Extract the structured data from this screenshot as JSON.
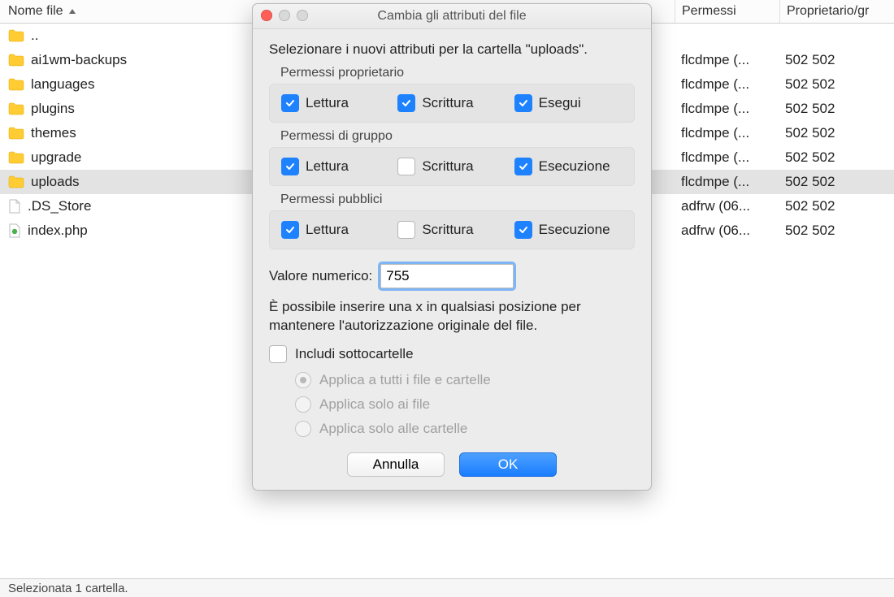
{
  "columns": {
    "name": "Nome file",
    "perm": "Permessi",
    "owner": "Proprietario/gr"
  },
  "files": [
    {
      "name": "..",
      "kind": "folder",
      "perm": "",
      "owner": "",
      "selected": false
    },
    {
      "name": "ai1wm-backups",
      "kind": "folder",
      "perm": "flcdmpe (...",
      "owner": "502 502",
      "selected": false
    },
    {
      "name": "languages",
      "kind": "folder",
      "perm": "flcdmpe (...",
      "owner": "502 502",
      "selected": false
    },
    {
      "name": "plugins",
      "kind": "folder",
      "perm": "flcdmpe (...",
      "owner": "502 502",
      "selected": false
    },
    {
      "name": "themes",
      "kind": "folder",
      "perm": "flcdmpe (...",
      "owner": "502 502",
      "selected": false
    },
    {
      "name": "upgrade",
      "kind": "folder",
      "perm": "flcdmpe (...",
      "owner": "502 502",
      "selected": false
    },
    {
      "name": "uploads",
      "kind": "folder",
      "perm": "flcdmpe (...",
      "owner": "502 502",
      "selected": true
    },
    {
      "name": ".DS_Store",
      "kind": "file",
      "perm": "adfrw (06...",
      "owner": "502 502",
      "selected": false
    },
    {
      "name": "index.php",
      "kind": "php",
      "perm": "adfrw (06...",
      "owner": "502 502",
      "selected": false
    }
  ],
  "status": "Selezionata 1 cartella.",
  "dialog": {
    "title": "Cambia gli attributi del file",
    "intro": "Selezionare i nuovi attributi per la cartella \"uploads\".",
    "groups": [
      {
        "label": "Permessi proprietario",
        "perms": [
          {
            "label": "Lettura",
            "checked": true
          },
          {
            "label": "Scrittura",
            "checked": true
          },
          {
            "label": "Esegui",
            "checked": true
          }
        ]
      },
      {
        "label": "Permessi di gruppo",
        "perms": [
          {
            "label": "Lettura",
            "checked": true
          },
          {
            "label": "Scrittura",
            "checked": false
          },
          {
            "label": "Esecuzione",
            "checked": true
          }
        ]
      },
      {
        "label": "Permessi pubblici",
        "perms": [
          {
            "label": "Lettura",
            "checked": true
          },
          {
            "label": "Scrittura",
            "checked": false
          },
          {
            "label": "Esecuzione",
            "checked": true
          }
        ]
      }
    ],
    "numeric_label": "Valore numerico:",
    "numeric_value": "755",
    "hint": "È possibile inserire una x in qualsiasi posizione per mantenere l'autorizzazione originale del file.",
    "recurse": {
      "label": "Includi sottocartelle",
      "checked": false
    },
    "radios": [
      {
        "label": "Applica a tutti i file e cartelle",
        "selected": true
      },
      {
        "label": "Applica solo ai file",
        "selected": false
      },
      {
        "label": "Applica solo alle cartelle",
        "selected": false
      }
    ],
    "cancel": "Annulla",
    "ok": "OK"
  }
}
